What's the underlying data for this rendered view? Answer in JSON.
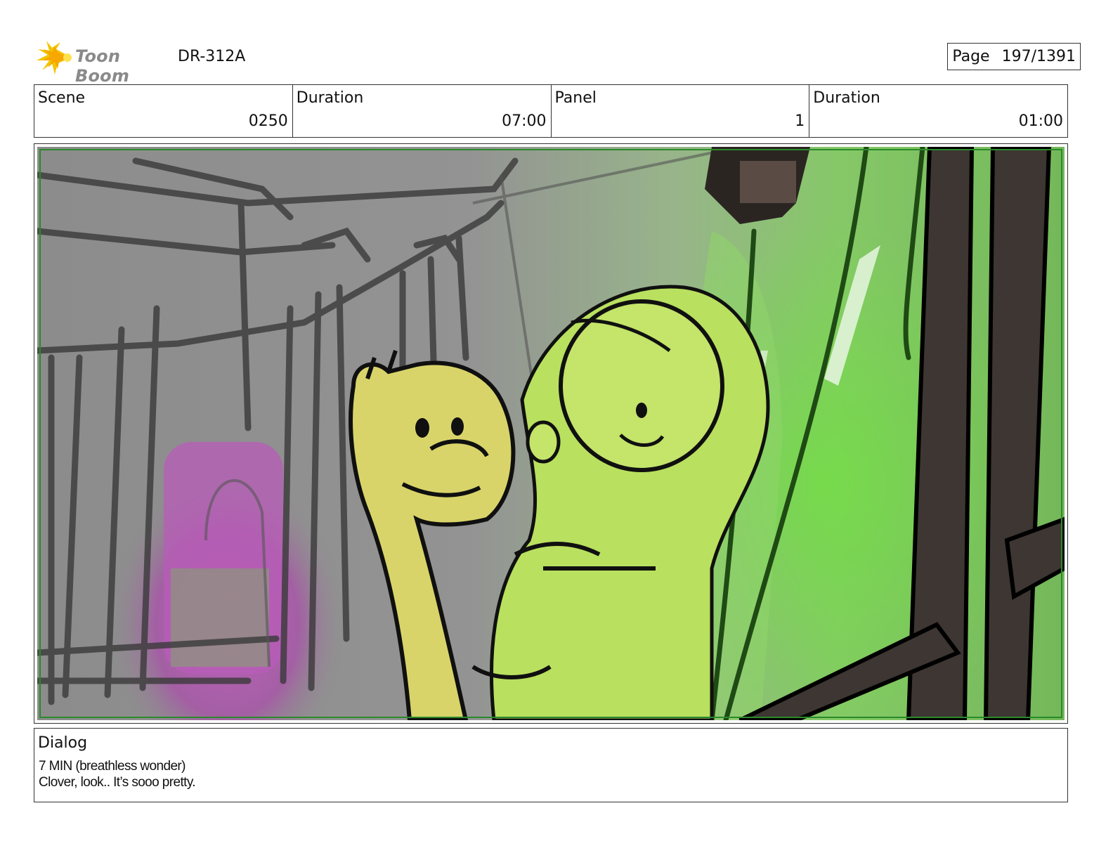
{
  "header": {
    "brand": "Toon Boom",
    "project_code": "DR-312A",
    "page_label": "Page",
    "page_value": "197/1391"
  },
  "info": [
    {
      "label": "Scene",
      "value": "0250"
    },
    {
      "label": "Duration",
      "value": "07:00"
    },
    {
      "label": "Panel",
      "value": "1"
    },
    {
      "label": "Duration",
      "value": "01:00"
    }
  ],
  "panel": {
    "colors": {
      "background_gray": "#8f8f8f",
      "green_glow": "#7fd35a",
      "character_yellow": "#d9d66a",
      "character_green": "#b4e05c",
      "magenta_glow": "#c35ac0",
      "dark_frame": "#3d3632"
    }
  },
  "dialog": {
    "title": "Dialog",
    "line1": "7 MIN (breathless wonder)",
    "line2": "Clover, look.. It’s sooo pretty."
  }
}
